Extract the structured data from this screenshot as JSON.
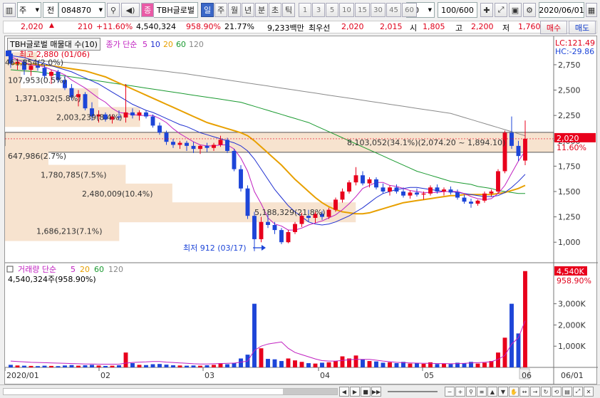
{
  "toolbar": {
    "market": "주",
    "mode": "전",
    "code": "084870",
    "stock_name": "TBH글로벌",
    "badge": "종",
    "periods": [
      "일",
      "주",
      "월",
      "년",
      "분",
      "초",
      "틱"
    ],
    "active_period": "일",
    "minutes": [
      "1",
      "3",
      "5",
      "10",
      "15",
      "30",
      "45",
      "60"
    ],
    "count_select": "10",
    "range": "100/600",
    "date": "2020/06/01"
  },
  "quote": {
    "price": "2,020",
    "change": "210",
    "change_pct": "+11.60%",
    "volume": "4,540,324",
    "volume_pct": "958.90%",
    "turnover": "21.77%",
    "amount": "9,233백만",
    "best_ask_label": "최우선",
    "best_ask": "2,020",
    "best_bid": "2,015",
    "open_label": "시",
    "open": "1,805",
    "high_label": "고",
    "high": "2,200",
    "low_label": "저",
    "low": "1,760",
    "buy": "매수",
    "sell": "매도"
  },
  "legend_price": {
    "box": "TBH글로벌 매물대 수(10)",
    "ma_label": "종가 단순",
    "ma": [
      "5",
      "10",
      "20",
      "60",
      "120"
    ],
    "ma_colors": [
      "#c020c0",
      "#1f2fd0",
      "#e8a000",
      "#1a9a30",
      "#888888"
    ]
  },
  "legend_vol": {
    "label": "거래량 단순",
    "ma": [
      "5",
      "20",
      "60",
      "120"
    ],
    "value": "4,540,324주(958.90%)"
  },
  "labels": {
    "high_mark": "최고 2,880 (01/06)",
    "low_mark": "최저 912 (03/17)",
    "lc": "LC:121.49",
    "hc": "HC:-29.86",
    "last_price": "2,020",
    "last_pct": "11.60%",
    "last_vol": "4,540K",
    "last_vol_pct": "958.90%"
  },
  "y_ticks": [
    "2,750",
    "2,500",
    "2,250",
    "2,000",
    "1,750",
    "1,500",
    "1,250",
    "1,000"
  ],
  "vol_ticks": [
    "3,000K",
    "2,000K",
    "1,000K"
  ],
  "x_ticks": [
    "2020/01",
    "02",
    "03",
    "04",
    "05",
    "06",
    "06/01"
  ],
  "profile": [
    {
      "label": "461,854(2.0%)",
      "price": 2775,
      "pct": 2.0
    },
    {
      "label": "107,953(0.5%)",
      "price": 2600,
      "pct": 0.5
    },
    {
      "label": "1,371,032(5.8%)",
      "price": 2420,
      "pct": 5.8
    },
    {
      "label": "2,003,239(8.4%)",
      "price": 2235,
      "pct": 8.4
    },
    {
      "label": "8,103,052(34.1%)(2,074.20 ~ 1,894.10)",
      "price": 1985,
      "pct": 34.1
    },
    {
      "label": "647,986(2.7%)",
      "price": 1850,
      "pct": 2.7
    },
    {
      "label": "1,780,785(7.5%)",
      "price": 1665,
      "pct": 7.5
    },
    {
      "label": "2,480,009(10.4%)",
      "price": 1480,
      "pct": 10.4
    },
    {
      "label": "5,188,329(21.8%)",
      "price": 1295,
      "pct": 21.8
    },
    {
      "label": "1,686,213(7.1%)",
      "price": 1110,
      "pct": 7.1
    }
  ],
  "chart_data": {
    "type": "candlestick",
    "ylim": [
      840,
      2960
    ],
    "vol_ylim": [
      0,
      4800
    ],
    "candles": [
      [
        2860,
        2880,
        2720,
        2760
      ],
      [
        2760,
        2810,
        2700,
        2780
      ],
      [
        2780,
        2800,
        2650,
        2700
      ],
      [
        2700,
        2760,
        2640,
        2740
      ],
      [
        2740,
        2790,
        2690,
        2720
      ],
      [
        2720,
        2750,
        2610,
        2640
      ],
      [
        2640,
        2700,
        2560,
        2680
      ],
      [
        2680,
        2700,
        2570,
        2600
      ],
      [
        2600,
        2640,
        2500,
        2520
      ],
      [
        2520,
        2560,
        2400,
        2430
      ],
      [
        2430,
        2500,
        2340,
        2460
      ],
      [
        2460,
        2480,
        2300,
        2320
      ],
      [
        2320,
        2380,
        2200,
        2240
      ],
      [
        2240,
        2300,
        2180,
        2260
      ],
      [
        2260,
        2280,
        2190,
        2210
      ],
      [
        2210,
        2260,
        2170,
        2240
      ],
      [
        2240,
        2300,
        2200,
        2230
      ],
      [
        2230,
        2560,
        2180,
        2280
      ],
      [
        2280,
        2320,
        2220,
        2250
      ],
      [
        2250,
        2300,
        2200,
        2280
      ],
      [
        2280,
        2300,
        2220,
        2240
      ],
      [
        2240,
        2260,
        2130,
        2150
      ],
      [
        2150,
        2180,
        2060,
        2080
      ],
      [
        2080,
        2100,
        1960,
        1990
      ],
      [
        1990,
        2020,
        1930,
        1960
      ],
      [
        1960,
        2000,
        1920,
        1980
      ],
      [
        1980,
        2000,
        1900,
        1950
      ],
      [
        1950,
        1990,
        1880,
        1920
      ],
      [
        1920,
        1960,
        1870,
        1950
      ],
      [
        1950,
        1980,
        1890,
        1930
      ],
      [
        1930,
        1980,
        1900,
        1960
      ],
      [
        1960,
        2050,
        1940,
        2010
      ],
      [
        2010,
        2030,
        1880,
        1900
      ],
      [
        1900,
        1920,
        1700,
        1720
      ],
      [
        1720,
        1760,
        1500,
        1530
      ],
      [
        1530,
        1560,
        1230,
        1260
      ],
      [
        1260,
        1300,
        912,
        1030
      ],
      [
        1030,
        1250,
        1000,
        1200
      ],
      [
        1200,
        1300,
        1140,
        1170
      ],
      [
        1170,
        1200,
        1080,
        1120
      ],
      [
        1120,
        1140,
        980,
        1000
      ],
      [
        1000,
        1120,
        990,
        1100
      ],
      [
        1100,
        1200,
        1080,
        1180
      ],
      [
        1180,
        1290,
        1150,
        1260
      ],
      [
        1260,
        1320,
        1200,
        1240
      ],
      [
        1240,
        1300,
        1190,
        1280
      ],
      [
        1280,
        1310,
        1220,
        1250
      ],
      [
        1250,
        1340,
        1230,
        1320
      ],
      [
        1320,
        1440,
        1300,
        1420
      ],
      [
        1420,
        1530,
        1390,
        1500
      ],
      [
        1500,
        1610,
        1480,
        1590
      ],
      [
        1590,
        1740,
        1560,
        1660
      ],
      [
        1660,
        1700,
        1560,
        1580
      ],
      [
        1580,
        1640,
        1540,
        1620
      ],
      [
        1620,
        1640,
        1520,
        1540
      ],
      [
        1540,
        1580,
        1480,
        1500
      ],
      [
        1500,
        1560,
        1460,
        1540
      ],
      [
        1540,
        1570,
        1480,
        1500
      ],
      [
        1500,
        1540,
        1440,
        1460
      ],
      [
        1460,
        1510,
        1430,
        1490
      ],
      [
        1490,
        1530,
        1450,
        1470
      ],
      [
        1470,
        1500,
        1420,
        1480
      ],
      [
        1480,
        1560,
        1460,
        1540
      ],
      [
        1540,
        1570,
        1480,
        1500
      ],
      [
        1500,
        1540,
        1460,
        1520
      ],
      [
        1520,
        1550,
        1470,
        1490
      ],
      [
        1490,
        1520,
        1420,
        1440
      ],
      [
        1440,
        1470,
        1380,
        1400
      ],
      [
        1400,
        1430,
        1340,
        1380
      ],
      [
        1380,
        1420,
        1360,
        1410
      ],
      [
        1410,
        1500,
        1390,
        1480
      ],
      [
        1480,
        1520,
        1450,
        1500
      ],
      [
        1500,
        1720,
        1480,
        1700
      ],
      [
        1700,
        2100,
        1680,
        2080
      ],
      [
        2080,
        2240,
        1920,
        1950
      ],
      [
        1950,
        2000,
        1800,
        1850
      ],
      [
        1805,
        2200,
        1760,
        2020
      ]
    ],
    "volumes": [
      120,
      90,
      80,
      70,
      60,
      80,
      70,
      60,
      90,
      110,
      80,
      100,
      120,
      90,
      70,
      80,
      100,
      700,
      200,
      120,
      110,
      150,
      160,
      130,
      100,
      90,
      80,
      90,
      80,
      100,
      120,
      200,
      150,
      210,
      420,
      600,
      3000,
      900,
      400,
      380,
      300,
      420,
      330,
      260,
      200,
      180,
      220,
      240,
      300,
      520,
      420,
      560,
      380,
      300,
      280,
      220,
      240,
      200,
      260,
      180,
      200,
      170,
      240,
      160,
      180,
      160,
      220,
      200,
      260,
      180,
      220,
      300,
      700,
      1400,
      3000,
      1600,
      4540
    ],
    "vol_ma5": [
      300,
      280,
      260,
      240,
      230,
      220,
      210,
      200,
      190,
      180,
      170,
      160,
      160,
      150,
      150,
      150,
      150,
      200,
      230,
      250,
      260,
      280,
      280,
      250,
      230,
      210,
      190,
      170,
      160,
      160,
      170,
      180,
      190,
      200,
      250,
      300,
      800,
      1000,
      1100,
      1150,
      1200,
      900,
      700,
      600,
      500,
      400,
      320,
      300,
      300,
      330,
      360,
      380,
      380,
      380,
      340,
      300,
      270,
      240,
      220,
      210,
      200,
      190,
      190,
      180,
      180,
      170,
      180,
      190,
      210,
      220,
      240,
      270,
      380,
      560,
      1100,
      1400,
      2200
    ],
    "ma5": [
      2830,
      2800,
      2770,
      2750,
      2740,
      2730,
      2700,
      2680,
      2650,
      2600,
      2560,
      2520,
      2470,
      2420,
      2380,
      2320,
      2280,
      2270,
      2260,
      2250,
      2250,
      2250,
      2220,
      2180,
      2120,
      2070,
      2030,
      1990,
      1960,
      1950,
      1950,
      1960,
      1960,
      1920,
      1830,
      1700,
      1500,
      1380,
      1240,
      1180,
      1160,
      1120,
      1120,
      1140,
      1170,
      1190,
      1210,
      1240,
      1270,
      1320,
      1380,
      1450,
      1530,
      1560,
      1590,
      1590,
      1560,
      1550,
      1530,
      1510,
      1500,
      1490,
      1490,
      1490,
      1500,
      1500,
      1500,
      1480,
      1450,
      1430,
      1420,
      1430,
      1480,
      1560,
      1680,
      1800,
      1900
    ],
    "ma10": [
      2840,
      2830,
      2820,
      2800,
      2780,
      2760,
      2740,
      2720,
      2700,
      2680,
      2650,
      2620,
      2590,
      2560,
      2520,
      2480,
      2440,
      2400,
      2360,
      2330,
      2300,
      2280,
      2250,
      2220,
      2190,
      2160,
      2140,
      2110,
      2080,
      2060,
      2040,
      2020,
      2000,
      1980,
      1950,
      1900,
      1820,
      1720,
      1620,
      1520,
      1440,
      1360,
      1300,
      1250,
      1200,
      1180,
      1170,
      1180,
      1200,
      1230,
      1260,
      1300,
      1340,
      1390,
      1440,
      1480,
      1500,
      1520,
      1530,
      1540,
      1540,
      1530,
      1520,
      1510,
      1500,
      1500,
      1490,
      1480,
      1470,
      1460,
      1450,
      1450,
      1460,
      1490,
      1540,
      1600,
      1670
    ],
    "ma20": [
      2760,
      2760,
      2760,
      2755,
      2750,
      2745,
      2740,
      2730,
      2720,
      2710,
      2700,
      2690,
      2670,
      2650,
      2630,
      2600,
      2570,
      2540,
      2510,
      2480,
      2450,
      2420,
      2390,
      2360,
      2330,
      2300,
      2270,
      2240,
      2210,
      2180,
      2160,
      2140,
      2120,
      2100,
      2080,
      2050,
      2000,
      1940,
      1880,
      1820,
      1760,
      1690,
      1620,
      1560,
      1500,
      1440,
      1390,
      1350,
      1320,
      1300,
      1290,
      1280,
      1280,
      1290,
      1310,
      1330,
      1350,
      1370,
      1390,
      1400,
      1410,
      1420,
      1430,
      1440,
      1450,
      1460,
      1460,
      1470,
      1470,
      1470,
      1470,
      1470,
      1480,
      1490,
      1510,
      1530,
      1560
    ],
    "ma60": [
      2700,
      2695,
      2690,
      2685,
      2680,
      2670,
      2660,
      2650,
      2640,
      2630,
      2620,
      2610,
      2600,
      2590,
      2580,
      2570,
      2560,
      2550,
      2540,
      2530,
      2520,
      2510,
      2500,
      2490,
      2480,
      2470,
      2460,
      2450,
      2440,
      2430,
      2420,
      2410,
      2400,
      2390,
      2380,
      2360,
      2340,
      2320,
      2300,
      2280,
      2260,
      2240,
      2220,
      2200,
      2180,
      2150,
      2120,
      2090,
      2060,
      2030,
      2000,
      1970,
      1940,
      1910,
      1880,
      1850,
      1820,
      1790,
      1760,
      1730,
      1700,
      1680,
      1660,
      1640,
      1620,
      1600,
      1590,
      1580,
      1570,
      1550,
      1540,
      1530,
      1510,
      1500,
      1490,
      1480,
      1480
    ],
    "ma120": [
      2800,
      2797,
      2794,
      2791,
      2788,
      2785,
      2782,
      2778,
      2774,
      2770,
      2765,
      2760,
      2755,
      2750,
      2744,
      2738,
      2732,
      2726,
      2720,
      2714,
      2707,
      2700,
      2692,
      2684,
      2676,
      2668,
      2660,
      2650,
      2640,
      2630,
      2620,
      2610,
      2600,
      2590,
      2580,
      2570,
      2560,
      2550,
      2540,
      2530,
      2520,
      2510,
      2500,
      2490,
      2480,
      2470,
      2460,
      2450,
      2440,
      2430,
      2420,
      2410,
      2400,
      2390,
      2380,
      2370,
      2360,
      2350,
      2340,
      2330,
      2320,
      2310,
      2300,
      2290,
      2280,
      2270,
      2250,
      2230,
      2210,
      2190,
      2170,
      2150,
      2130,
      2110,
      2090,
      2070,
      2050
    ]
  }
}
